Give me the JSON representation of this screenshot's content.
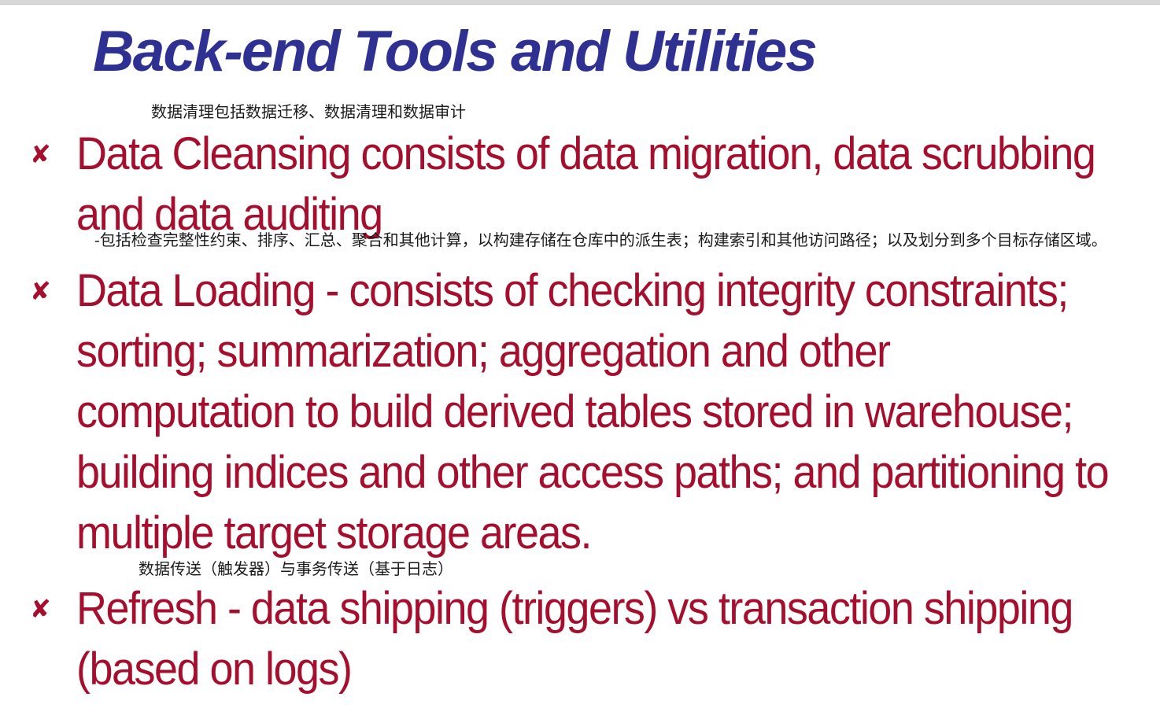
{
  "slide": {
    "title": "Back-end Tools and Utilities"
  },
  "notes": {
    "cleansing_cn": "数据清理包括数据迁移、数据清理和数据审计",
    "loading_cn": "-包括检查完整性约束、排序、汇总、聚合和其他计算，以构建存储在仓库中的派生表；构建索引和其他访问路径；以及划分到多个目标存储区域。",
    "refresh_cn": "数据传送（触发器）与事务传送（基于日志）"
  },
  "bullets": {
    "marker": "✘",
    "items": [
      {
        "text": "Data Cleansing consists of data migration, data scrubbing and data auditing"
      },
      {
        "text": "Data Loading - consists of checking integrity constraints; sorting; summarization; aggregation and other computation to build derived tables stored in warehouse; building indices and other access paths; and partitioning to multiple target storage areas."
      },
      {
        "text": "Refresh - data shipping (triggers) vs transaction shipping (based on logs)"
      }
    ]
  },
  "colors": {
    "title": "#2e3192",
    "bullet": "#a50f2d",
    "note": "#1a1a1a"
  }
}
